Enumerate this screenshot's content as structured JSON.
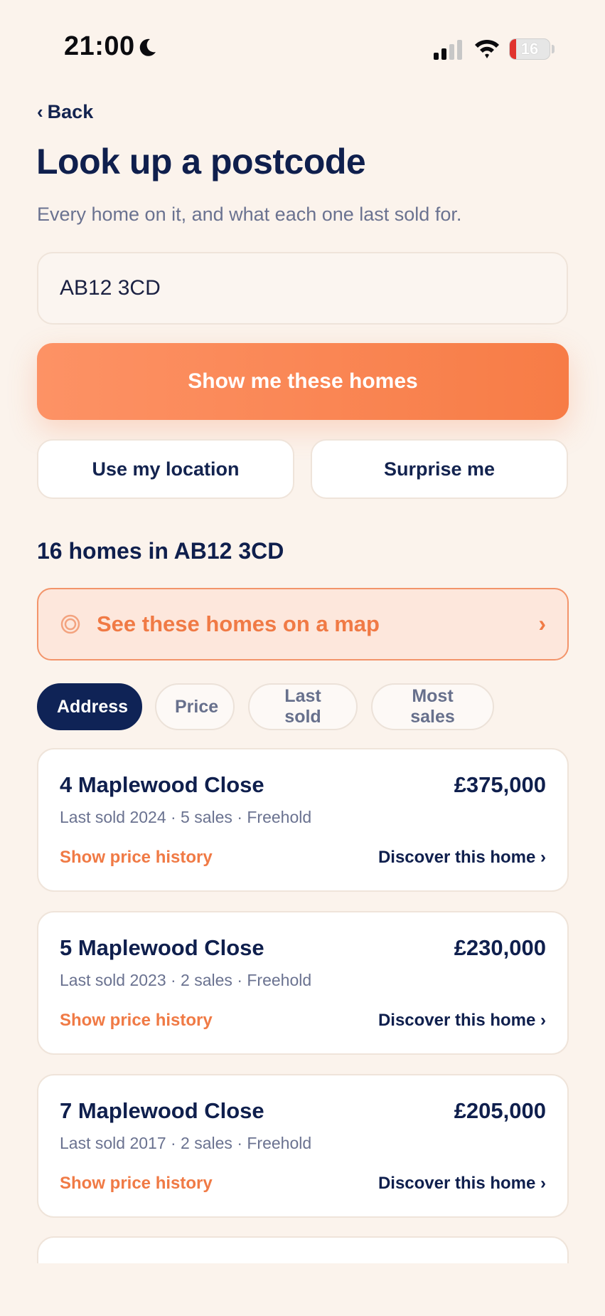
{
  "status_bar": {
    "time": "21:00",
    "battery_level": "16"
  },
  "header": {
    "back_label": "Back",
    "title": "Look up a postcode",
    "subtitle": "Every home on it, and what each one last sold for."
  },
  "search": {
    "value": "AB12 3CD"
  },
  "actions": {
    "primary_label": "Show me these homes",
    "location_label": "Use my location",
    "surprise_label": "Surprise me"
  },
  "results": {
    "heading": "16 homes in AB12 3CD",
    "map_banner_label": "See these homes on a map",
    "map_banner_arrow": "›"
  },
  "sort": {
    "chips": [
      {
        "label": "Address",
        "active": true
      },
      {
        "label": "Price",
        "active": false
      },
      {
        "label": "Last sold",
        "active": false
      },
      {
        "label": "Most sales",
        "active": false
      }
    ]
  },
  "homes": [
    {
      "address": "4 Maplewood Close",
      "price": "£375,000",
      "meta": "Last sold 2024 · 5 sales · Freehold",
      "history_label": "Show price history",
      "discover_label": "Discover this home ›"
    },
    {
      "address": "5 Maplewood Close",
      "price": "£230,000",
      "meta": "Last sold 2023 · 2 sales · Freehold",
      "history_label": "Show price history",
      "discover_label": "Discover this home ›"
    },
    {
      "address": "7 Maplewood Close",
      "price": "£205,000",
      "meta": "Last sold 2017 · 2 sales · Freehold",
      "history_label": "Show price history",
      "discover_label": "Discover this home ›"
    }
  ],
  "colors": {
    "background": "#fbf3ec",
    "accent": "#f07a45",
    "navy": "#0f1f4d"
  }
}
